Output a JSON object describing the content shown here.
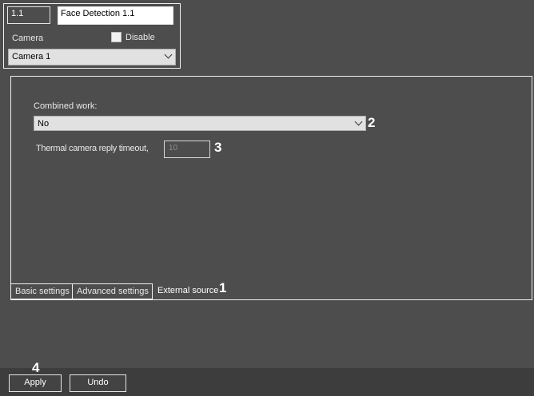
{
  "header": {
    "id_value": "1.1",
    "name_value": "Face Detection 1.1",
    "camera_label": "Camera",
    "disable_label": "Disable",
    "camera_selected": "Camera 1"
  },
  "settings": {
    "combined_label": "Combined work:",
    "combined_selected": "No",
    "thermal_label": "Thermal camera reply timeout,",
    "timeout_value": "10"
  },
  "tabs": [
    {
      "label": "Basic settings"
    },
    {
      "label": "Advanced settings"
    },
    {
      "label": "External source",
      "active": true
    }
  ],
  "callouts": [
    "1",
    "2",
    "3",
    "4"
  ],
  "buttons": {
    "apply_label": "Apply",
    "undo_label": "Undo"
  },
  "colors": {
    "background": "#4d4d4d",
    "bottom_bar": "#3d3d3d",
    "border": "#f0f0f0"
  }
}
